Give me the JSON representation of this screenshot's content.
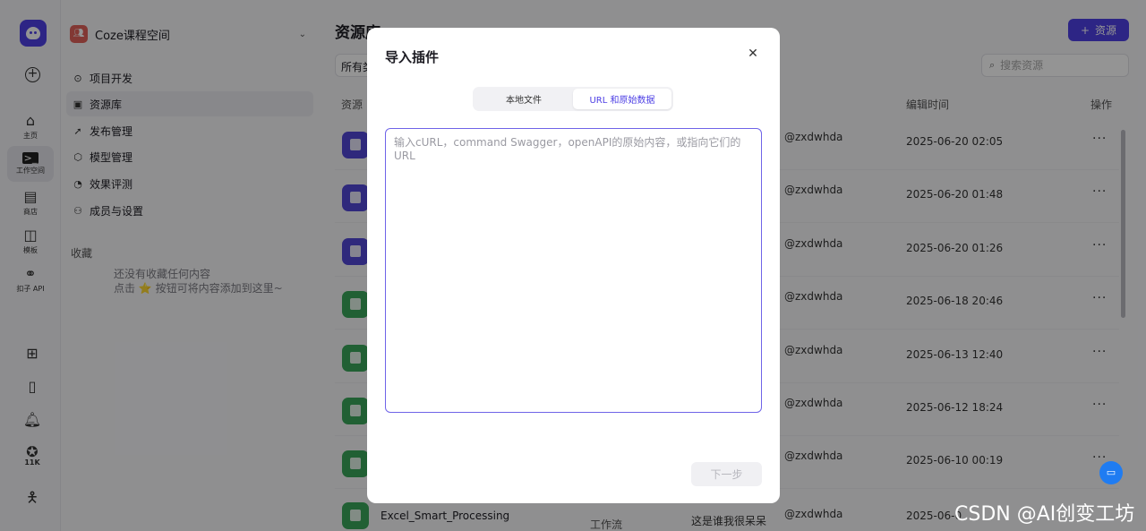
{
  "rail": {
    "items": [
      {
        "label": "主页",
        "icon": "home-icon"
      },
      {
        "label": "工作空间",
        "icon": "terminal-icon"
      },
      {
        "label": "商店",
        "icon": "store-icon"
      },
      {
        "label": "模板",
        "icon": "template-icon"
      },
      {
        "label": "扣子 API",
        "icon": "link-icon"
      }
    ],
    "star_count": "11K"
  },
  "sidebar": {
    "space_name": "Coze课程空间",
    "nav": [
      {
        "label": "项目开发",
        "icon": "project-icon"
      },
      {
        "label": "资源库",
        "icon": "library-icon"
      },
      {
        "label": "发布管理",
        "icon": "rocket-icon"
      },
      {
        "label": "模型管理",
        "icon": "model-icon"
      },
      {
        "label": "效果评测",
        "icon": "gauge-icon"
      },
      {
        "label": "成员与设置",
        "icon": "members-icon"
      }
    ],
    "favorites_title": "收藏",
    "favorites_empty_line1": "还没有收藏任何内容",
    "favorites_empty_line2": "点击 ⭐ 按钮可将内容添加到这里~"
  },
  "main": {
    "title": "资源库",
    "add_button": "资源",
    "filter_label": "所有类",
    "search_placeholder": "搜索资源",
    "columns": {
      "resource": "资源",
      "edit_time": "编辑时间",
      "action": "操作"
    },
    "rows": [
      {
        "kind": "plugin",
        "owner": "@zxdwhda",
        "time": "2025-06-20 02:05"
      },
      {
        "kind": "plugin",
        "owner": "@zxdwhda",
        "time": "2025-06-20 01:48"
      },
      {
        "kind": "plugin",
        "owner": "@zxdwhda",
        "time": "2025-06-20 01:26"
      },
      {
        "kind": "flow",
        "owner": "@zxdwhda",
        "time": "2025-06-18 20:46"
      },
      {
        "kind": "flow",
        "owner": "@zxdwhda",
        "time": "2025-06-13 12:40"
      },
      {
        "kind": "flow",
        "owner": "@zxdwhda",
        "time": "2025-06-12 18:24"
      },
      {
        "kind": "flow",
        "owner": "@zxdwhda",
        "time": "2025-06-10 00:19"
      }
    ],
    "partial_row": {
      "name": "Excel_Smart_Processing",
      "type": "工作流",
      "owner_name": "这是谁我很呆呆",
      "owner": "@zxdwhda",
      "time": "2025-06-0"
    }
  },
  "modal": {
    "title": "导入插件",
    "tabs": [
      "本地文件",
      "URL 和原始数据"
    ],
    "active_tab": 1,
    "textarea_placeholder": "输入cURL，command Swagger，openAPI的原始内容，或指向它们的URL",
    "next_button": "下一步"
  },
  "watermark": "CSDN @AI创变工坊",
  "colors": {
    "accent": "#4e40e5",
    "plugin_icon": "#5147d6",
    "flow_icon": "#3aa55a"
  }
}
